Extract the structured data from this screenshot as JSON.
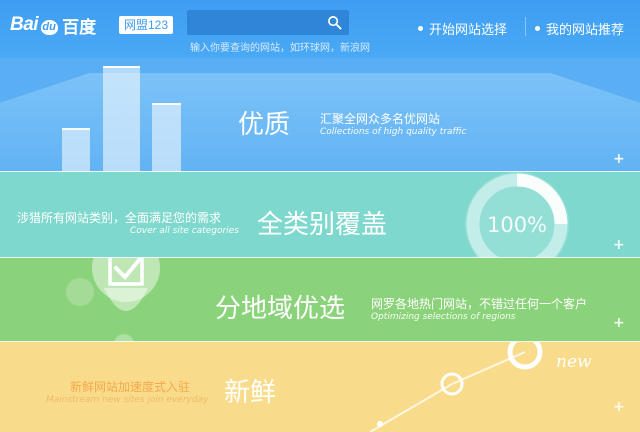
{
  "header": {
    "logo": {
      "latin_1": "Bai",
      "latin_2": "du",
      "chinese": "百度"
    },
    "badge": "网盟123",
    "search": {
      "hint": "输入你要查询的网站，如环球网，新浪网"
    },
    "nav": [
      {
        "label": "开始网站选择"
      },
      {
        "label": "我的网站推荐"
      }
    ]
  },
  "bands": {
    "quality": {
      "title": "优质",
      "subtitle_cn": "汇聚全网众多名优网站",
      "subtitle_en": "Collections of high quality traffic"
    },
    "coverage": {
      "title": "全类别覆盖",
      "subtitle_cn": "涉猎所有网站类别，全面满足您的需求",
      "subtitle_en": "Cover all site categories",
      "gauge_label": "100%",
      "gauge_level": 100
    },
    "regional": {
      "title": "分地域优选",
      "subtitle_cn": "网罗各地热门网站，不错过任何一个客户",
      "subtitle_en": "Optimizing selections of regions"
    },
    "fresh": {
      "title": "新鲜",
      "subtitle_cn": "新鲜网站加速度式入驻",
      "subtitle_en": "Mainstream new sites join everyday",
      "tag": "new"
    }
  },
  "colors": {
    "header": "#3e9df2",
    "blue_band": "#5aaef3",
    "cyan_band": "#7fd8cd",
    "green_band": "#8bd37a",
    "yellow_band": "#f8dc8c",
    "orange_text": "#f4a94a"
  },
  "icons": [
    "search-icon",
    "bar-chart-icon",
    "gauge-icon",
    "checkbox-pin-icon",
    "trend-line-icon",
    "plus-icon"
  ]
}
